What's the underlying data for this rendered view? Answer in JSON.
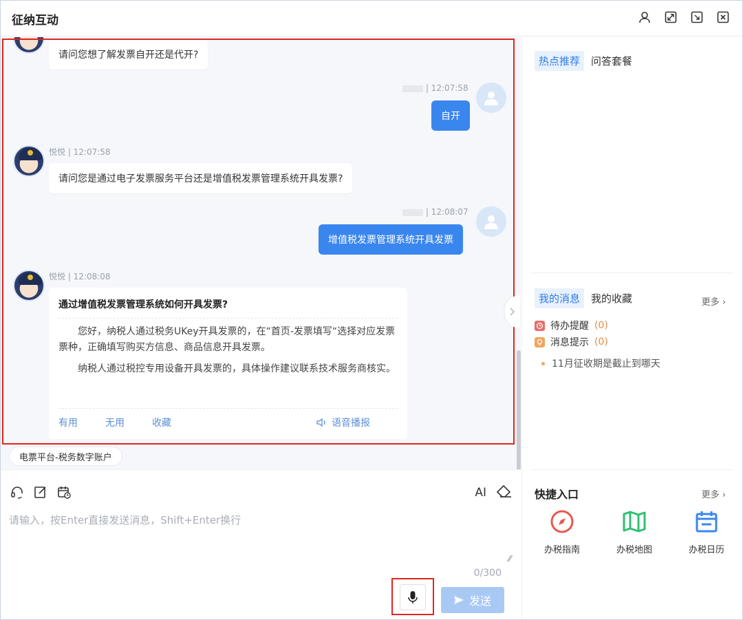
{
  "window": {
    "title": "征纳互动"
  },
  "chat": {
    "messages": [
      {
        "role": "bot",
        "text": "请问您想了解发票自开还是代开?"
      },
      {
        "role": "user",
        "time": "| 12:07:58",
        "text": "自开"
      },
      {
        "role": "bot",
        "sender": "悦悦 | 12:07:58",
        "text": "请问您是通过电子发票服务平台还是增值税发票管理系统开具发票?"
      },
      {
        "role": "user",
        "time": "| 12:08:07",
        "text": "增值税发票管理系统开具发票"
      }
    ],
    "answer": {
      "sender": "悦悦 | 12:08:08",
      "title": "通过增值税发票管理系统如何开具发票?",
      "p1": "您好，纳税人通过税务UKey开具发票的，在“首页-发票填写“选择对应发票票种，正确填写购买方信息、商品信息开具发票。",
      "p2": "纳税人通过税控专用设备开具发票的，具体操作建议联系技术服务商核实。",
      "actions": {
        "useful": "有用",
        "useless": "无用",
        "favorite": "收藏",
        "voice": "语音播报"
      }
    },
    "topic_chip": "电票平台-税务数字账户"
  },
  "input": {
    "ai_label": "AI",
    "placeholder": "请输入，按Enter直接发送消息，Shift+Enter换行",
    "counter": "0/300",
    "send_label": "发送"
  },
  "sidebar": {
    "top_tabs": {
      "active": "热点推荐",
      "other": "问答套餐"
    },
    "msg_tabs": {
      "active": "我的消息",
      "other": "我的收藏",
      "more": "更多"
    },
    "todo": {
      "label": "待办提醒",
      "count": "(0)"
    },
    "notice": {
      "label": "消息提示",
      "count": "(0)"
    },
    "hot_question": "11月征收期是截止到哪天",
    "quick": {
      "title": "快捷入口",
      "more": "更多",
      "items": [
        {
          "label": "办税指南",
          "icon": "compass-icon"
        },
        {
          "label": "办税地图",
          "icon": "map-icon"
        },
        {
          "label": "办税日历",
          "icon": "calendar-icon"
        }
      ]
    }
  },
  "colors": {
    "accent": "#3a86ef",
    "highlight_red": "#e0251e",
    "orange": "#e98b43",
    "green": "#2fbf71"
  }
}
